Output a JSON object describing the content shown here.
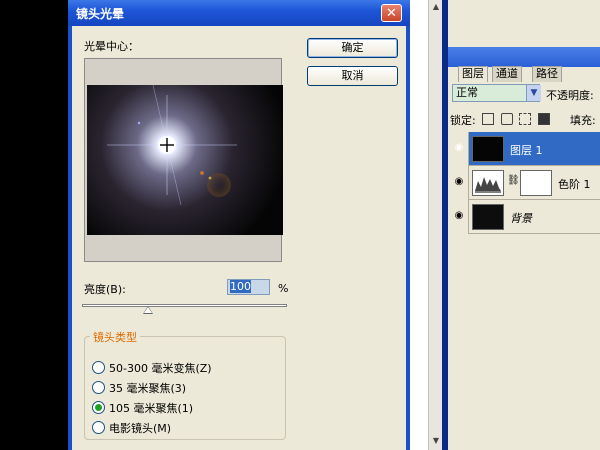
{
  "dialog": {
    "title": "镜头光晕",
    "close_glyph": "✕",
    "flare_center_label": "光晕中心：",
    "ok_label": "确定",
    "cancel_label": "取消",
    "brightness_label": "亮度(B):",
    "brightness_value": "100",
    "brightness_unit": "%",
    "brightness_fraction": 0.32,
    "lens_type_title": "镜头类型",
    "lens_options": [
      {
        "label": "50-300 毫米变焦(Z)",
        "selected": false
      },
      {
        "label": "35 毫米聚焦(3)",
        "selected": false
      },
      {
        "label": "105 毫米聚焦(1)",
        "selected": true
      },
      {
        "label": "电影镜头(M)",
        "selected": false
      }
    ]
  },
  "layers_panel": {
    "tabs": [
      "图层",
      "通道",
      "路径"
    ],
    "blend_mode": "正常",
    "blend_arrow": "▼",
    "opacity_label": "不透明度:",
    "lock_label": "锁定:",
    "fill_label": "填充:",
    "eye_glyph": "◉",
    "layers": [
      {
        "name": "图层 1",
        "selected": true
      },
      {
        "name": "色阶 1",
        "selected": false
      },
      {
        "name": "背景",
        "selected": false
      }
    ]
  },
  "scrollbar": {
    "up_glyph": "▲",
    "down_glyph": "▼"
  },
  "colors": {
    "title_blue": "#1e56d8",
    "dialog_bg": "#ece9d8",
    "selection_blue": "#316ac5",
    "group_title_orange": "#e06b00"
  }
}
